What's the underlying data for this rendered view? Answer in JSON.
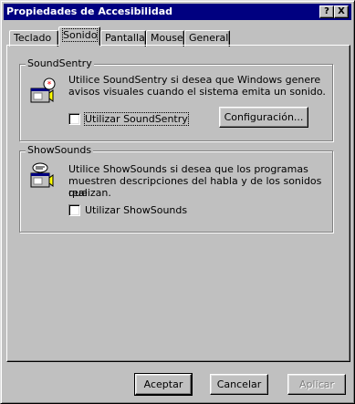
{
  "window": {
    "title": "Propiedades de Accesibilidad",
    "help_button": "?",
    "close_button": "X"
  },
  "tabs": [
    {
      "label": "Teclado"
    },
    {
      "label": "Sonido"
    },
    {
      "label": "Pantalla"
    },
    {
      "label": "Mouse"
    },
    {
      "label": "General"
    }
  ],
  "active_tab": "Sonido",
  "soundsentry": {
    "group_label": "SoundSentry",
    "icon": "soundsentry-icon",
    "description_1": "Utilice SoundSentry si desea que Windows genere",
    "description_2": "avisos visuales cuando el sistema emita un sonido.",
    "checkbox_label": "Utilizar SoundSentry",
    "checked": false,
    "settings_button": "Configuración..."
  },
  "showsounds": {
    "group_label": "ShowSounds",
    "icon": "showsounds-icon",
    "description_1": "Utilice ShowSounds si desea que los programas",
    "description_2": "muestren descripciones del habla y de los sonidos que",
    "description_3": "realizan.",
    "checkbox_label": "Utilizar ShowSounds",
    "checked": false
  },
  "footer": {
    "ok_button": "Aceptar",
    "cancel_button": "Cancelar",
    "apply_button": "Aplicar",
    "apply_disabled": true
  },
  "colors": {
    "titlebar": "#000080",
    "face": "#c0c0c0",
    "disabled_text": "#808080"
  }
}
